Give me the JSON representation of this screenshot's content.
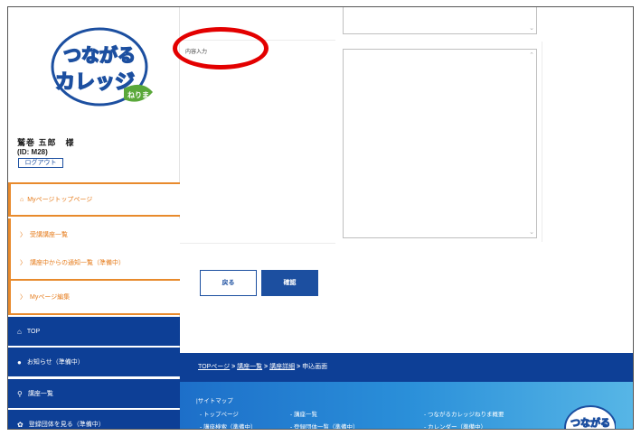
{
  "sidebar": {
    "user_name": "鷲巻 五郎　様",
    "user_id": "(ID: M28)",
    "logout_label": "ログアウト",
    "logo_text_top": "つながる",
    "logo_text_bottom": "カレッジ",
    "logo_badge": "ねりま",
    "menu_orange": [
      {
        "label": "Myページトップページ",
        "icon": "home-icon"
      },
      {
        "label": "受講講座一覧",
        "icon": "chevron-right-icon"
      },
      {
        "label": "講座中からの通知一覧（準備中）",
        "icon": "chevron-right-icon"
      },
      {
        "label": "Myページ編集",
        "icon": "chevron-right-icon"
      }
    ],
    "menu_blue": [
      {
        "label": "TOP",
        "icon": "home-icon"
      },
      {
        "label": "お知らせ（準備中）",
        "icon": "info-icon"
      },
      {
        "label": "講座一覧",
        "icon": "search-icon"
      },
      {
        "label": "登録団体を見る（準備中）",
        "icon": "gear-icon"
      }
    ]
  },
  "form": {
    "field_label": "内容入力",
    "back_label": "戻る",
    "confirm_label": "確認"
  },
  "breadcrumb": {
    "items": [
      "TOPページ",
      "講座一覧",
      "講座詳細",
      "申込画面"
    ],
    "separator": " > "
  },
  "footer": {
    "sitemap_title": "|サイトマップ",
    "links_col1": [
      "- トップページ",
      "- 講座検索（準備中）"
    ],
    "links_col2": [
      "- 講座一覧",
      "- 登録団体一覧（準備中）"
    ],
    "links_col3": [
      "- つながるカレッジねりま概要",
      "- カレンダー（準備中）"
    ]
  },
  "colors": {
    "accent_orange": "#e88a2c",
    "nav_blue": "#0d3f96",
    "annotation_red": "#e30000"
  }
}
